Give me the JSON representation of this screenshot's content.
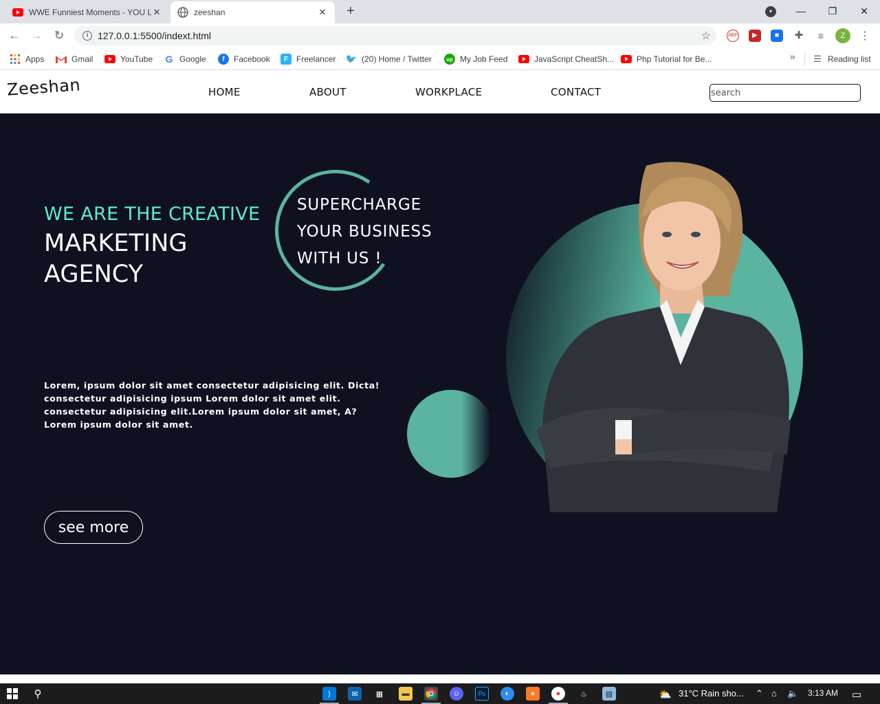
{
  "browser": {
    "tabs": [
      {
        "title": "WWE Funniest Moments - YOU L",
        "icon": "youtube-icon",
        "active": false
      },
      {
        "title": "zeeshan",
        "icon": "globe-icon",
        "active": true
      }
    ],
    "new_tab": "+",
    "window_controls": {
      "minimize": "—",
      "restore": "❐",
      "close": "✕"
    },
    "url": "127.0.0.1:5500/indext.html",
    "profile_initial": "Z",
    "bookmarks": [
      {
        "label": "Apps",
        "icon": "apps-grid-icon"
      },
      {
        "label": "Gmail",
        "icon": "gmail-icon"
      },
      {
        "label": "YouTube",
        "icon": "youtube-icon"
      },
      {
        "label": "Google",
        "icon": "google-icon"
      },
      {
        "label": "Facebook",
        "icon": "facebook-icon"
      },
      {
        "label": "Freelancer",
        "icon": "freelancer-icon"
      },
      {
        "label": "(20) Home / Twitter",
        "icon": "twitter-icon"
      },
      {
        "label": "My Job Feed",
        "icon": "upwork-icon"
      },
      {
        "label": "JavaScript CheatSh...",
        "icon": "youtube-icon"
      },
      {
        "label": "Php Tutorial for Be...",
        "icon": "youtube-icon"
      }
    ],
    "bookmarks_overflow": "»",
    "reading_list": "Reading list"
  },
  "site": {
    "logo": "Zeeshan",
    "nav": [
      "HOME",
      "ABOUT",
      "WORKPLACE",
      "CONTACT"
    ],
    "search_placeholder": "search"
  },
  "hero": {
    "tagline": "WE ARE THE CREATIVE",
    "headline_1": "MARKETING",
    "headline_2": "AGENCY",
    "slogan": [
      "SUPERCHARGE",
      "YOUR BUSINESS",
      "WITH US !"
    ],
    "body": "Lorem, ipsum dolor sit amet consectetur adipisicing elit. Dicta! consectetur adipisicing ipsum Lorem dolor sit amet elit. consectetur adipisicing elit.Lorem ipsum dolor sit amet, A? Lorem ipsum dolor sit amet.",
    "cta": "see more",
    "accent_color": "#5eead4",
    "circle_color": "#5ab4a0",
    "background_color": "#0f1121"
  },
  "taskbar": {
    "weather": "31°C  Rain sho...",
    "time": "3:13 AM"
  }
}
